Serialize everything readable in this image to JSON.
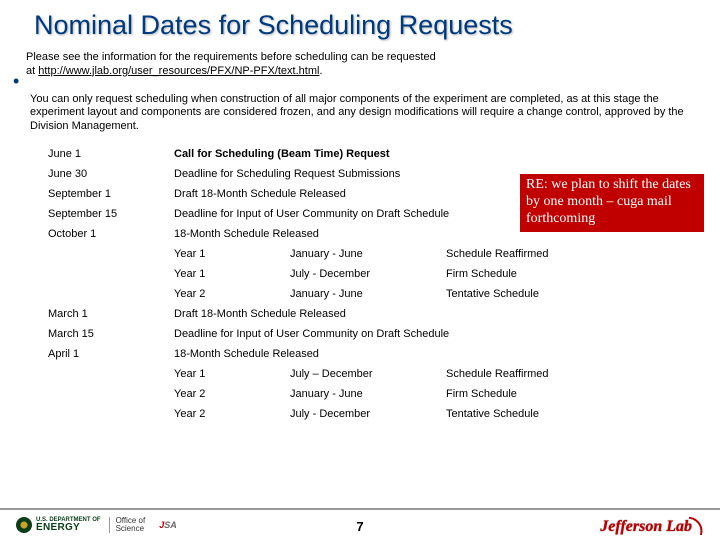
{
  "title": "Nominal Dates for Scheduling Requests",
  "intro_line1": "Please see the information for the requirements before scheduling can be requested",
  "intro_line2_prefix": "at ",
  "intro_link": "http://www.jlab.org/user_resources/PFX/NP-PFX/text.html",
  "intro_line2_suffix": ".",
  "para2": "You can only request scheduling when construction of all major components of the experiment are completed, as at this stage the experiment layout and components are considered frozen, and any design modifications will require a change control, approved by the Division Management.",
  "rows1": [
    {
      "date": "June 1",
      "desc": "Call for Scheduling (Beam Time) Request",
      "bold": true
    },
    {
      "date": "June 30",
      "desc": "Deadline for Scheduling Request Submissions"
    },
    {
      "date": "September 1",
      "desc": "Draft 18-Month Schedule Released"
    },
    {
      "date": "September 15",
      "desc": "Deadline for Input of User Community on Draft Schedule"
    },
    {
      "date": "October 1",
      "desc": "18-Month Schedule Released"
    }
  ],
  "sub1": [
    {
      "y": "Year 1",
      "m": "January - June",
      "s": "Schedule Reaffirmed"
    },
    {
      "y": "Year 1",
      "m": "July - December",
      "s": "Firm Schedule"
    },
    {
      "y": "Year 2",
      "m": "January - June",
      "s": "Tentative Schedule"
    }
  ],
  "rows2": [
    {
      "date": "March 1",
      "desc": "Draft 18-Month Schedule Released"
    },
    {
      "date": "March 15",
      "desc": "Deadline for Input of User Community on Draft Schedule"
    },
    {
      "date": "April 1",
      "desc": "18-Month Schedule Released"
    }
  ],
  "sub2": [
    {
      "y": "Year 1",
      "m": "July – December",
      "s": "Schedule Reaffirmed"
    },
    {
      "y": "Year 2",
      "m": "January - June",
      "s": "Firm Schedule"
    },
    {
      "y": "Year 2",
      "m": "July - December",
      "s": "Tentative Schedule"
    }
  ],
  "callout": "RE: we plan to shift the dates by one month – cuga mail forthcoming",
  "footer": {
    "doe_top": "U.S. DEPARTMENT OF",
    "doe_bottom": "ENERGY",
    "office_l1": "Office of",
    "office_l2": "Science",
    "jsa": "JSA",
    "pagenum": "7",
    "jlab": "Jefferson Lab"
  }
}
